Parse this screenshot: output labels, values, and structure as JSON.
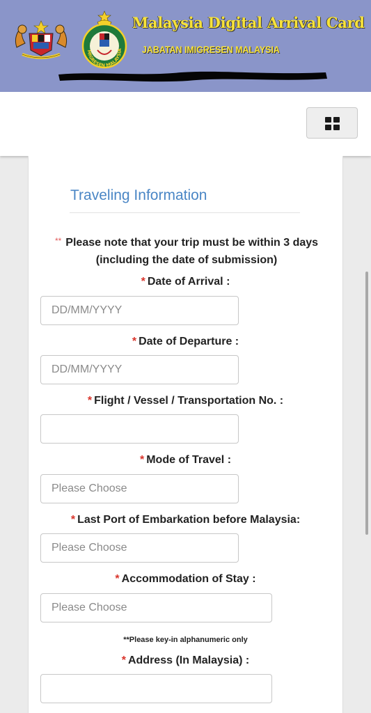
{
  "header": {
    "title": "Malaysia Digital Arrival Card",
    "subtitle": "JABATAN IMIGRESEN MALAYSIA",
    "background_color": "#8a95c9",
    "title_color": "#f7e23a",
    "crest_icon": "malaysia-coat-of-arms-icon",
    "seal_icon": "imigresen-malaysia-seal-icon",
    "seal_text": "IMIGRESEN MALAYSIA"
  },
  "navbar": {
    "menu_icon": "grid-menu-icon"
  },
  "form": {
    "section_title": "Traveling Information",
    "note_stars": "**",
    "note": "Please note that your trip must be within 3 days (including the date of submission)",
    "required_marker": "*",
    "fields": {
      "arrival": {
        "label": "Date of Arrival :",
        "placeholder": "DD/MM/YYYY",
        "value": ""
      },
      "departure": {
        "label": "Date of Departure :",
        "placeholder": "DD/MM/YYYY",
        "value": ""
      },
      "transport_no": {
        "label": "Flight / Vessel / Transportation No. :",
        "placeholder": "",
        "value": ""
      },
      "mode": {
        "label": "Mode of Travel :",
        "placeholder": "Please Choose",
        "value": ""
      },
      "last_port": {
        "label": "Last Port of Embarkation before Malaysia:",
        "placeholder": "Please Choose",
        "value": ""
      },
      "accommodation": {
        "label": "Accommodation of Stay :",
        "placeholder": "Please Choose",
        "value": ""
      },
      "address": {
        "label": "Address (In Malaysia) :",
        "placeholder": "",
        "value": ""
      }
    },
    "address_hint": "**Please key-in alphanumeric only",
    "accent_color": "#4a86c5",
    "required_color": "#d9342b"
  }
}
